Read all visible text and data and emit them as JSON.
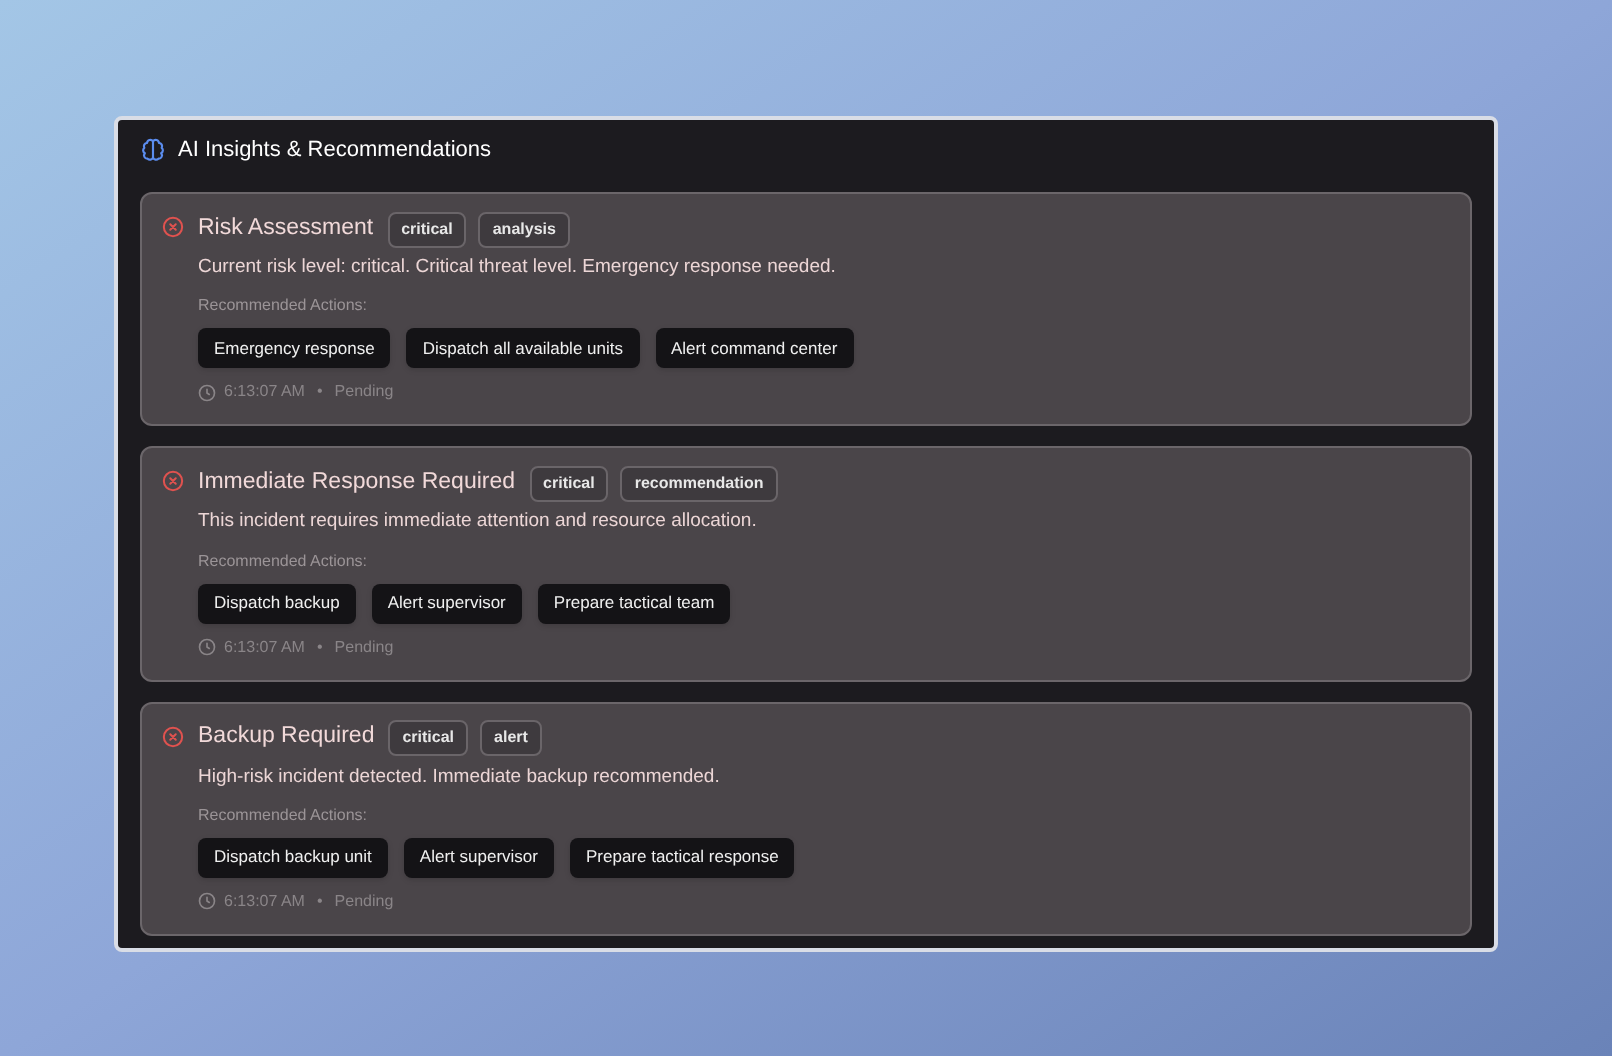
{
  "panel": {
    "title": "AI Insights & Recommendations"
  },
  "insights": [
    {
      "title": "Risk Assessment",
      "severity": "critical",
      "category": "analysis",
      "description": "Current risk level: critical. Critical threat level. Emergency response needed.",
      "actions_label": "Recommended Actions:",
      "actions": [
        "Emergency response",
        "Dispatch all available units",
        "Alert command center"
      ],
      "time": "6:13:07 AM",
      "separator": "•",
      "status": "Pending"
    },
    {
      "title": "Immediate Response Required",
      "severity": "critical",
      "category": "recommendation",
      "description": "This incident requires immediate attention and resource allocation.",
      "actions_label": "Recommended Actions:",
      "actions": [
        "Dispatch backup",
        "Alert supervisor",
        "Prepare tactical team"
      ],
      "time": "6:13:07 AM",
      "separator": "•",
      "status": "Pending"
    },
    {
      "title": "Backup Required",
      "severity": "critical",
      "category": "alert",
      "description": "High-risk incident detected. Immediate backup recommended.",
      "actions_label": "Recommended Actions:",
      "actions": [
        "Dispatch backup unit",
        "Alert supervisor",
        "Prepare tactical response"
      ],
      "time": "6:13:07 AM",
      "separator": "•",
      "status": "Pending"
    }
  ]
}
